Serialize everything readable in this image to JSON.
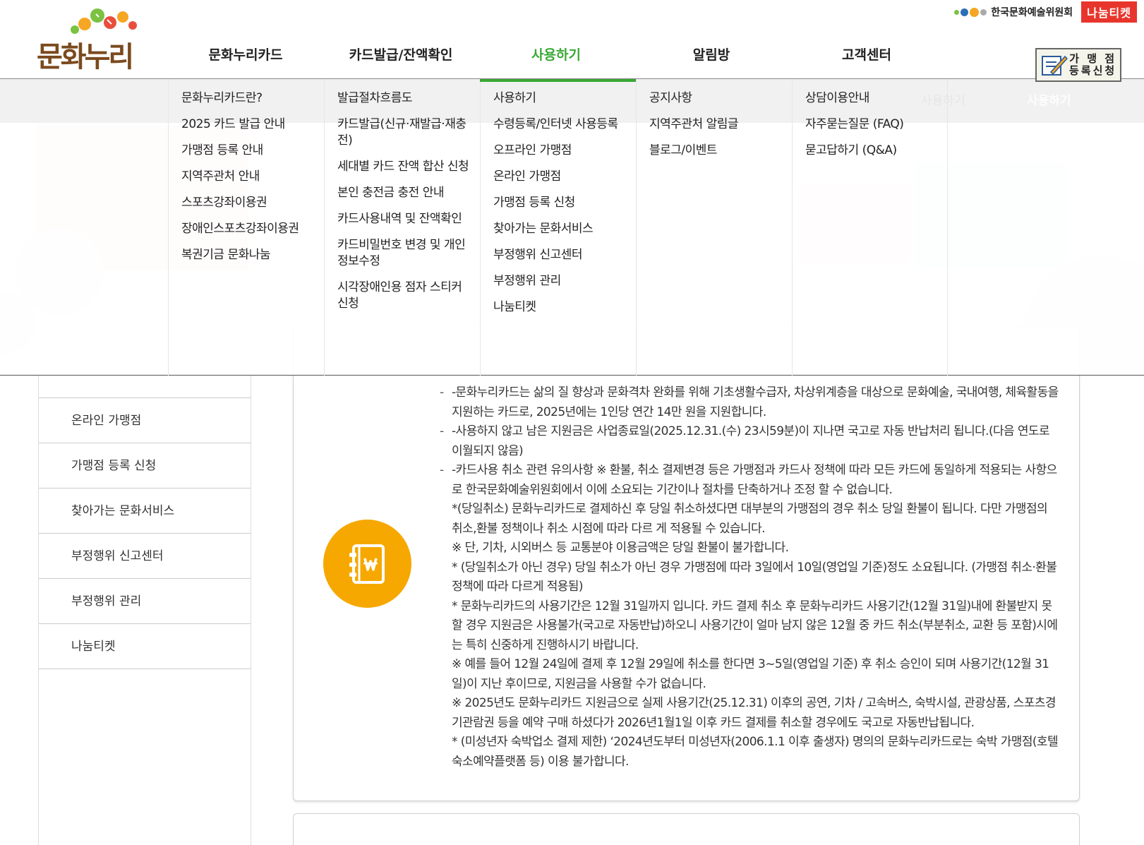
{
  "header": {
    "logo_text": "문화누리",
    "gnb": [
      {
        "label": "문화누리카드",
        "active": false
      },
      {
        "label": "카드발급/잔액확인",
        "active": false
      },
      {
        "label": "사용하기",
        "active": true
      },
      {
        "label": "알림방",
        "active": false
      },
      {
        "label": "고객센터",
        "active": false
      }
    ],
    "org_name": "한국문화예술위원회",
    "nanum_ticket": "나눔티켓",
    "register_button": {
      "line1": "가 맹 점",
      "line2": "등록신청"
    }
  },
  "mega_menu": {
    "columns": [
      {
        "items": [
          "문화누리카드란?",
          "2025 카드 발급 안내",
          "가맹점 등록 안내",
          "지역주관처 안내",
          "스포츠강좌이용권",
          "장애인스포츠강좌이용권",
          "복권기금 문화나눔"
        ]
      },
      {
        "items": [
          "발급절차흐름도",
          "카드발급(신규·재발급·재충전)",
          "세대별 카드 잔액 합산 신청",
          "본인 충전금 충전 안내",
          "카드사용내역 및 잔액확인",
          "카드비밀번호 변경 및 개인정보수정",
          "시각장애인용 점자 스티커 신청"
        ]
      },
      {
        "items": [
          "사용하기",
          "수령등록/인터넷 사용등록",
          "오프라인 가맹점",
          "온라인 가맹점",
          "가맹점 등록 신청",
          "찾아가는 문화서비스",
          "부정행위 신고센터",
          "부정행위 관리",
          "나눔티켓"
        ]
      },
      {
        "items": [
          "공지사항",
          "지역주관처 알림글",
          "블로그/이벤트"
        ]
      },
      {
        "items": [
          "상담이용안내",
          "자주묻는질문 (FAQ)",
          "묻고답하기 (Q&A)"
        ]
      }
    ],
    "ghost_labels": [
      "사용하기",
      "사용하기"
    ]
  },
  "side_menu": {
    "items": [
      "온라인 가맹점",
      "가맹점 등록 신청",
      "찾아가는 문화서비스",
      "부정행위 신고센터",
      "부정행위 관리",
      "나눔티켓"
    ]
  },
  "content": {
    "paragraphs": [
      {
        "dash": true,
        "text": "-문화누리카드는 삶의 질 향상과 문화격차 완화를 위해 기초생활수급자, 차상위계층을 대상으로 문화예술, 국내여행, 체육활동을 지원하는 카드로, 2025년에는 1인당 연간 14만 원을 지원합니다."
      },
      {
        "dash": true,
        "text": "-사용하지 않고 남은 지원금은 사업종료일(2025.12.31.(수) 23시59분)이 지나면 국고로 자동 반납처리 됩니다.(다음 연도로 이월되지 않음)"
      },
      {
        "dash": true,
        "text": "-카드사용 취소 관련 유의사항 ※ 환불, 취소 결제변경 등은 가맹점과 카드사 정책에 따라 모든 카드에 동일하게 적용되는 사항으로 한국문화예술위원회에서 이에 소요되는 기간이나 절차를 단축하거나 조정 할 수 없습니다."
      },
      {
        "dash": false,
        "text": "*(당일취소) 문화누리카드로 결제하신 후 당일 취소하셨다면 대부분의 가맹점의 경우 취소 당일 환불이 됩니다. 다만 가맹점의 취소,환불 정책이나 취소 시점에 따라 다르 게 적용될 수 있습니다."
      },
      {
        "dash": false,
        "text": "※ 단, 기차, 시외버스 등 교통분야 이용금액은 당일 환불이 불가합니다."
      },
      {
        "dash": false,
        "text": "* (당일취소가 아닌 경우) 당일 취소가 아닌 경우 가맹점에 따라 3일에서 10일(영업일 기준)정도 소요됩니다. (가맹점 취소·환불 정책에 따라 다르게 적용됨)"
      },
      {
        "dash": false,
        "text": "* 문화누리카드의 사용기간은 12월 31일까지 입니다. 카드 결제 취소 후 문화누리카드 사용기간(12월 31일)내에 환불받지 못할 경우 지원금은 사용불가(국고로 자동반납)하오니 사용기간이 얼마 남지 않은 12월 중 카드 취소(부분취소, 교환 등 포함)시에는 특히 신중하게 진행하시기 바랍니다."
      },
      {
        "dash": false,
        "text": "※ 예를 들어 12월 24일에 결제 후 12월 29일에 취소를 한다면 3~5일(영업일 기준) 후 취소 승인이 되며 사용기간(12월 31일)이 지난 후이므로, 지원금을 사용할 수가 없습니다."
      },
      {
        "dash": false,
        "text": "※ 2025년도 문화누리카드 지원금으로 실제 사용기간(25.12.31) 이후의 공연, 기차 / 고속버스, 숙박시설, 관광상품, 스포츠경기관람권 등을 예약 구매 하셨다가 2026년1월1일 이후 카드 결제를 취소할 경우에도 국고로 자동반납됩니다."
      },
      {
        "dash": false,
        "text": "* (미성년자 숙박업소 결제 제한) ‘2024년도부터 미성년자(2006.1.1 이후 출생자) 명의의 문화누리카드로는 숙박 가맹점(호텔 숙소예약플랫폼 등) 이용 불가합니다."
      }
    ]
  },
  "colors": {
    "accent_green": "#3aa935",
    "card_icon_bg": "#f6a800",
    "nanum_red": "#e8352c"
  }
}
